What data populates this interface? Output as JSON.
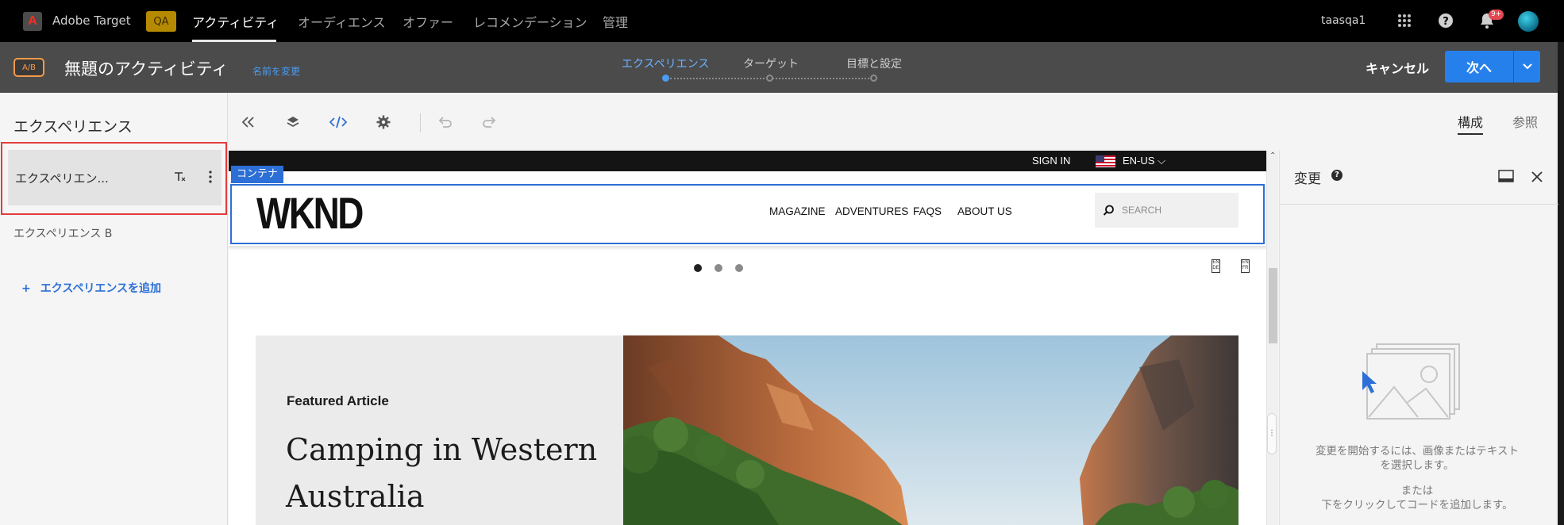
{
  "topnav": {
    "app_name": "Adobe Target",
    "env_badge": "QA",
    "items": [
      "アクティビティ",
      "オーディエンス",
      "オファー",
      "レコメンデーション",
      "管理"
    ],
    "user": "taasqa1",
    "notification_badge": "9+"
  },
  "activity": {
    "type_badge": "A/B",
    "title": "無題のアクティビティ",
    "rename": "名前を変更",
    "steps": [
      "エクスペリエンス",
      "ターゲット",
      "目標と設定"
    ],
    "cancel": "キャンセル",
    "next": "次へ"
  },
  "left_panel": {
    "title": "エクスペリエンス",
    "experiences": [
      "エクスペリエン...",
      "エクスペリエンス B"
    ],
    "add": "エクスペリエンスを追加"
  },
  "toolbar": {
    "tab_compose": "構成",
    "tab_browse": "参照"
  },
  "canvas": {
    "container_tag": "コンテナ",
    "signin": "SIGN IN",
    "locale": "EN-US",
    "logo": "WKND",
    "nav": [
      "MAGAZINE",
      "ADVENTURES",
      "FAQS",
      "ABOUT US"
    ],
    "search_placeholder": "SEARCH",
    "featured_label": "Featured Article",
    "featured_title": "Camping in Western Australia"
  },
  "right_panel": {
    "title": "変更",
    "empty_text": "変更を開始するには、画像またはテキストを選択します。",
    "or_text": "または",
    "code_text": "下をクリックしてコードを追加します。"
  },
  "colors": {
    "accent": "#2680eb",
    "selection_border": "#e53b3b",
    "active_step": "#6bb2ff",
    "ab_badge": "#f59a46"
  }
}
